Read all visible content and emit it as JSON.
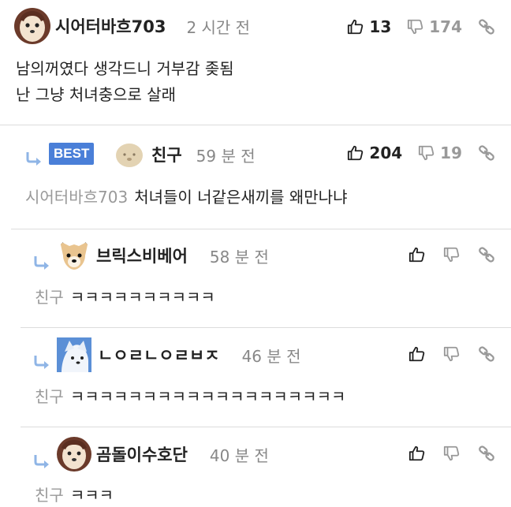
{
  "comments": [
    {
      "nick": "시어터바흐703",
      "time": "2 시간 전",
      "up": "13",
      "down": "174",
      "lines": [
        "남의꺼였다 생각드니 거부감 좆됨",
        "난 그냥 처녀충으로 살래"
      ]
    },
    {
      "badge": "BEST",
      "nick": "친구",
      "time": "59 분 전",
      "up": "204",
      "down": "19",
      "mention": "시어터바흐703",
      "text": "처녀들이 너같은새끼를 왜만나냐"
    },
    {
      "nick": "브릭스비베어",
      "time": "58 분 전",
      "mention": "친구",
      "text": "ㅋㅋㅋㅋㅋㅋㅋㅋㅋㅋ"
    },
    {
      "nick": "ㄴㅇㄹㄴㅇㄹㅂㅈ",
      "time": "46 분 전",
      "mention": "친구",
      "text": "ㅋㅋㅋㅋㅋㅋㅋㅋㅋㅋㅋㅋㅋㅋㅋㅋㅋㅋㅋ"
    },
    {
      "nick": "곰돌이수호단",
      "time": "40 분 전",
      "mention": "친구",
      "text": "ㅋㅋㅋ"
    }
  ],
  "colors": {
    "best_badge": "#4a7fd8",
    "mention": "#999999",
    "divider": "#dcdcdc"
  },
  "icons": [
    "thumbs-up-icon",
    "thumbs-down-icon",
    "link-icon",
    "reply-arrow-icon"
  ]
}
